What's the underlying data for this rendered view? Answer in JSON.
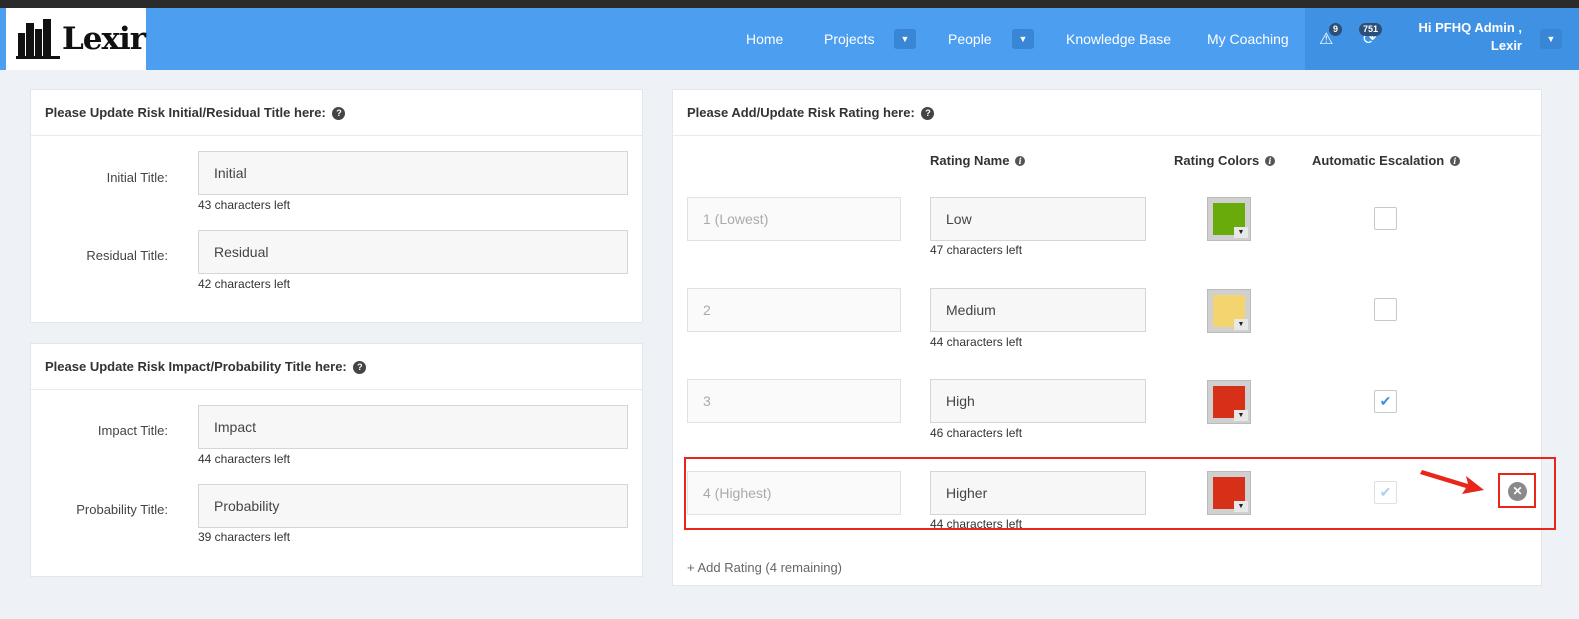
{
  "brand": {
    "name": "Lexir"
  },
  "nav": {
    "items": [
      {
        "label": "Home"
      },
      {
        "label": "Projects"
      },
      {
        "label": "People"
      },
      {
        "label": "Knowledge Base"
      },
      {
        "label": "My Coaching"
      }
    ],
    "alerts_count": "9",
    "updates_count": "751",
    "user_greeting_line1": "Hi PFHQ Admin ,",
    "user_greeting_line2": "Lexir"
  },
  "title_panel": {
    "heading": "Please Update Risk Initial/Residual Title here:",
    "fields": [
      {
        "label": "Initial Title:",
        "value": "Initial",
        "hint": "43 characters left"
      },
      {
        "label": "Residual Title:",
        "value": "Residual",
        "hint": "42 characters left"
      }
    ]
  },
  "impact_panel": {
    "heading": "Please Update Risk Impact/Probability Title here:",
    "fields": [
      {
        "label": "Impact Title:",
        "value": "Impact",
        "hint": "44 characters left"
      },
      {
        "label": "Probability Title:",
        "value": "Probability",
        "hint": "39 characters left"
      }
    ]
  },
  "rating_panel": {
    "heading": "Please Add/Update Risk Rating here:",
    "columns": {
      "name": "Rating Name",
      "colors": "Rating Colors",
      "escalation": "Automatic Escalation"
    },
    "rows": [
      {
        "level": "1 (Lowest)",
        "name": "Low",
        "hint": "47 characters left",
        "color": "#6aab0c",
        "escalation": false
      },
      {
        "level": "2",
        "name": "Medium",
        "hint": "44 characters left",
        "color": "#f3d46e",
        "escalation": false
      },
      {
        "level": "3",
        "name": "High",
        "hint": "46 characters left",
        "color": "#d63018",
        "escalation": true
      },
      {
        "level": "4 (Highest)",
        "name": "Higher",
        "hint": "44 characters left",
        "color": "#d63018",
        "escalation": true
      }
    ],
    "add_label": "+ Add Rating (4 remaining)"
  },
  "icons": {
    "question": "?",
    "info": "i",
    "caret": "▼",
    "check": "✔",
    "delete": "✕",
    "warning": "⚠"
  },
  "colors": {
    "navbar": "#4b9ef0",
    "highlight": "#e8261a"
  }
}
